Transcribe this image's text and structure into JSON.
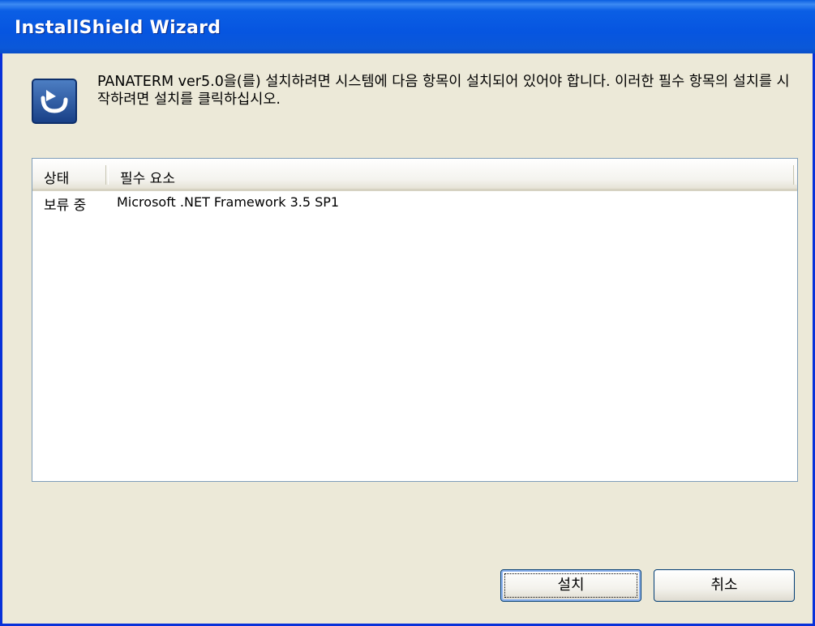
{
  "window": {
    "title": "InstallShield Wizard"
  },
  "header": {
    "icon": "installer-icon",
    "message": "PANATERM ver5.0을(를) 설치하려면 시스템에 다음 항목이 설치되어 있어야 합니다. 이러한 필수 항목의 설치를 시작하려면 설치를 클릭하십시오."
  },
  "list": {
    "columns": [
      "상태",
      "필수 요소"
    ],
    "rows": [
      {
        "status": "보류 중",
        "name": "Microsoft .NET Framework 3.5 SP1"
      }
    ]
  },
  "buttons": {
    "install": "설치",
    "cancel": "취소"
  },
  "colors": {
    "titlebar": "#0655e0",
    "dialog_bg": "#ece9d8",
    "list_border": "#7f9db9"
  }
}
